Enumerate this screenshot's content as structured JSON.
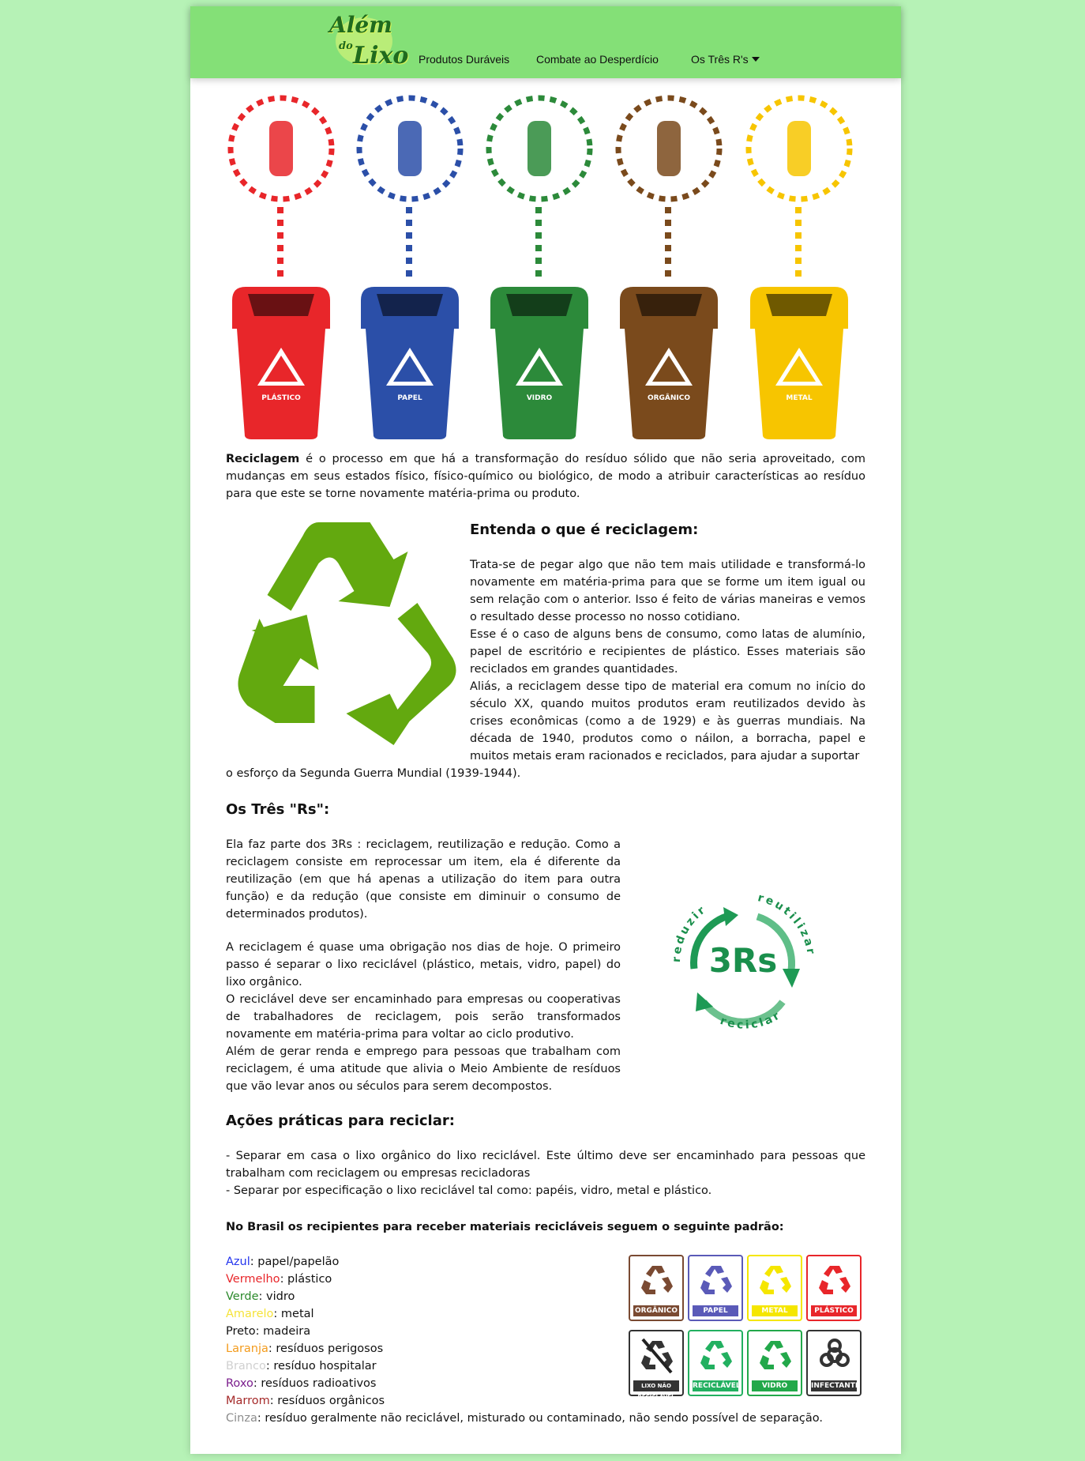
{
  "brand": {
    "logo_line1": "Além",
    "logo_line2": "do",
    "logo_line3": "Lixo"
  },
  "nav": {
    "items": [
      {
        "label": "Produtos Duráveis"
      },
      {
        "label": "Combate ao Desperdício"
      },
      {
        "label": "Os Três R's"
      }
    ]
  },
  "colors": {
    "page_bg": "#b6f2b6",
    "navbar": "#84e077",
    "plastico": "#e8262a",
    "papel": "#2b4fa8",
    "vidro": "#2c8a3a",
    "organico": "#7a4a1c",
    "metal": "#f7c500"
  },
  "bins": [
    {
      "label": "PLÁSTICO",
      "icon": "bottle-icon",
      "color": "#e8262a"
    },
    {
      "label": "PAPEL",
      "icon": "paper-icon",
      "color": "#2b4fa8"
    },
    {
      "label": "VIDRO",
      "icon": "jar-icon",
      "color": "#2c8a3a"
    },
    {
      "label": "ORGÂNICO",
      "icon": "apple-icon",
      "color": "#7a4a1c"
    },
    {
      "label": "METAL",
      "icon": "can-icon",
      "color": "#f7c500"
    }
  ],
  "intro": {
    "term": "Reciclagem",
    "text": " é o processo em que há a transformação do resíduo sólido que não seria aproveitado, com mudanças em seus estados físico, físico-químico ou biológico, de modo a atribuir características ao resíduo para que este se torne novamente matéria-prima ou produto."
  },
  "section1": {
    "title": "Entenda o que é reciclagem:",
    "p1": "Trata-se de pegar algo que não tem mais utilidade e transformá-lo novamente em matéria-prima para que se forme um item igual ou sem relação com o anterior. Isso é feito de várias maneiras e vemos o resultado desse processo no nosso cotidiano.",
    "p2": "Esse é o caso de alguns bens de consumo, como latas de alumínio, papel de escritório e recipientes de plástico. Esses materiais são reciclados em grandes quantidades.",
    "p3": "Aliás, a reciclagem desse tipo de material era comum no início do século XX, quando muitos produtos eram reutilizados devido às crises econômicas (como a de 1929) e às guerras mundiais. Na década de 1940, produtos como o náilon, a borracha, papel e muitos metais eram racionados e reciclados, para ajudar a suportar",
    "p3_tail": "o esforço da Segunda Guerra Mundial (1939-1944)."
  },
  "section2": {
    "title": "Os Três \"Rs\":",
    "p1": "Ela faz parte dos 3Rs : reciclagem, reutilização e redução. Como a reciclagem consiste em reprocessar um item, ela é diferente da reutilização (em que há apenas a utilização do item para outra função) e da redução (que consiste em diminuir o consumo de determinados produtos).",
    "p2": "A reciclagem é quase uma obrigação nos dias de hoje. O primeiro passo é separar o lixo reciclável (plástico, metais, vidro, papel) do lixo orgânico.",
    "p3": "O reciclável deve ser encaminhado para empresas ou cooperativas de trabalhadores de reciclagem, pois serão transformados novamente em matéria-prima para voltar ao ciclo produtivo.",
    "p4": "Além de gerar renda e emprego para pessoas que trabalham com reciclagem, é uma atitude que alivia o Meio Ambiente de resíduos que vão levar anos ou séculos para serem decompostos.",
    "badge_center": "3Rs",
    "badge_reduzir": "reduzir",
    "badge_reutilizar": "reutilizar",
    "badge_reciclar": "reciclar"
  },
  "section3": {
    "title": "Ações práticas para reciclar:",
    "line1": "- Separar em casa o lixo orgânico do lixo reciclável. Este último deve ser encaminhado para pessoas que trabalham com reciclagem ou empresas recicladoras",
    "line2": "- Separar por especificação o lixo reciclável tal como: papéis, vidro, metal e plástico."
  },
  "standard": {
    "title": "No Brasil os recipientes para receber materiais recicláveis seguem o seguinte padrão:",
    "entries": [
      {
        "color_name": "Azul",
        "desc": ": papel/papelão",
        "color": "#2233ee"
      },
      {
        "color_name": "Vermelho",
        "desc": ": plástico",
        "color": "#e8262a"
      },
      {
        "color_name": "Verde",
        "desc": ": vidro",
        "color": "#2c8a2c"
      },
      {
        "color_name": "Amarelo",
        "desc": ": metal",
        "color": "#f5e33a"
      },
      {
        "color_name": "Preto",
        "desc": ": madeira",
        "color": "#111111"
      },
      {
        "color_name": "Laranja",
        "desc": ": resíduos perigosos",
        "color": "#f39b1c"
      },
      {
        "color_name": "Branco",
        "desc": ": resíduo hospitalar",
        "color": "#d0d0d0"
      },
      {
        "color_name": "Roxo",
        "desc": ": resíduos radioativos",
        "color": "#7a1c8c"
      },
      {
        "color_name": "Marrom",
        "desc": ": resíduos orgânicos",
        "color": "#a52a2a"
      },
      {
        "color_name": "Cinza",
        "desc": ": resíduo geralmente não reciclável, misturado ou contaminado, não sendo possível de separação.",
        "color": "#8c8c8c"
      }
    ],
    "icons": [
      {
        "label": "ORGÂNICO",
        "color": "#7a4a32"
      },
      {
        "label": "PAPEL",
        "color": "#5a5ab8"
      },
      {
        "label": "METAL",
        "color": "#f5e600"
      },
      {
        "label": "PLÁSTICO",
        "color": "#e8262a"
      },
      {
        "label": "LIXO NÃO RECICLÁVEL",
        "color": "#333333"
      },
      {
        "label": "RECICLÁVEL",
        "color": "#22b060"
      },
      {
        "label": "VIDRO",
        "color": "#22a84a"
      },
      {
        "label": "INFECTANTE",
        "color": "#333333"
      }
    ]
  }
}
